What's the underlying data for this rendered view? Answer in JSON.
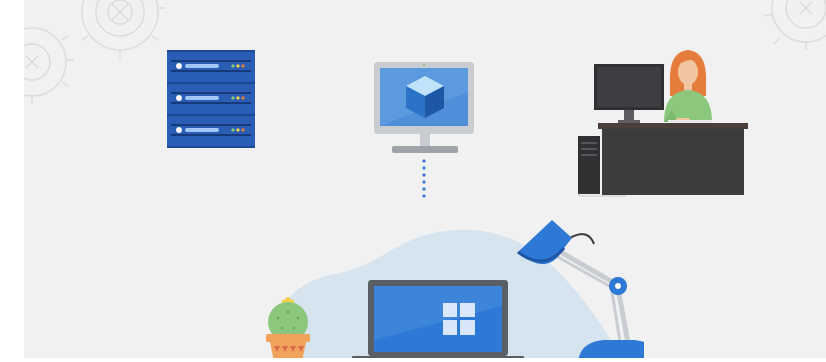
{
  "scene": {
    "colors": {
      "background": "#ffffff",
      "panel": "#f1f1f2",
      "gear_outline": "#dcdcde",
      "blob": "#d5e4ef",
      "server_blue": "#2a5db5",
      "server_blue_dark": "#1d4693",
      "server_stripe": "#16397a",
      "monitor_frame": "#c9ccd1",
      "monitor_screen": "#4f8fd9",
      "monitor_screen_light": "#8fbef0",
      "cube_top": "#bfe3fb",
      "cube_left": "#2a73c9",
      "cube_right": "#1d57a6",
      "dots": "#3b7dd8",
      "desk": "#3c3c3c",
      "desk_top": "#4a3e3a",
      "woman_shirt": "#8bc87d",
      "woman_hair": "#e57c3c",
      "skin": "#f2c6a0",
      "laptop_body": "#5a5f66",
      "laptop_screen": "#2e78d6",
      "lamp_blue": "#2e78d6",
      "lamp_arm": "#c9ccd1",
      "cactus": "#8bc87d",
      "pot": "#f2a35b",
      "pot_stripe": "#e06b4a"
    },
    "icons": [
      "gear-icon",
      "server-rack-icon",
      "virtual-machine-cube-icon",
      "connection-dots-icon",
      "office-worker-icon",
      "laptop-icon",
      "windows-logo-icon",
      "desk-lamp-icon",
      "potted-cactus-icon"
    ]
  }
}
